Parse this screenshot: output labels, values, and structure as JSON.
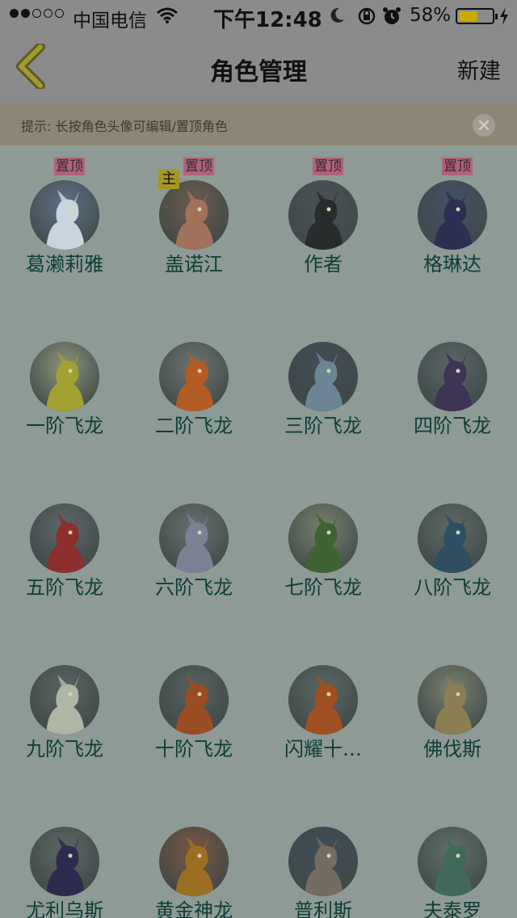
{
  "status_bar": {
    "carrier": "中国电信",
    "time": "下午12:48",
    "battery": "58%",
    "battery_level": 0.58,
    "signal_bars": 2
  },
  "nav": {
    "title": "角色管理",
    "new_label": "新建"
  },
  "tip": {
    "text": "提示: 长按角色头像可编辑/置顶角色"
  },
  "pin_label": "置顶",
  "main_label": "主",
  "characters": [
    {
      "name": "葛濑莉雅",
      "pinned": true,
      "main": false,
      "colors": [
        "#5f7087",
        "#c8d4de"
      ]
    },
    {
      "name": "盖诺江",
      "pinned": true,
      "main": true,
      "colors": [
        "#6b5a4b",
        "#a1715a"
      ]
    },
    {
      "name": "作者",
      "pinned": true,
      "main": false,
      "colors": [
        "#4b5256",
        "#292c2d"
      ]
    },
    {
      "name": "格琳达",
      "pinned": true,
      "main": false,
      "colors": [
        "#45506a",
        "#2d2f53"
      ]
    },
    {
      "name": "一阶飞龙",
      "pinned": false,
      "main": false,
      "colors": [
        "#8c937a",
        "#a3a032"
      ]
    },
    {
      "name": "二阶飞龙",
      "pinned": false,
      "main": false,
      "colors": [
        "#6c7471",
        "#b35d24"
      ]
    },
    {
      "name": "三阶飞龙",
      "pinned": false,
      "main": false,
      "colors": [
        "#424c56",
        "#6b8596"
      ]
    },
    {
      "name": "四阶飞龙",
      "pinned": false,
      "main": false,
      "colors": [
        "#5c6566",
        "#3d3456"
      ]
    },
    {
      "name": "五阶飞龙",
      "pinned": false,
      "main": false,
      "colors": [
        "#5e6668",
        "#8d2f2c"
      ]
    },
    {
      "name": "六阶飞龙",
      "pinned": false,
      "main": false,
      "colors": [
        "#68706f",
        "#7b8296"
      ]
    },
    {
      "name": "七阶飞龙",
      "pinned": false,
      "main": false,
      "colors": [
        "#79826d",
        "#3f6232"
      ]
    },
    {
      "name": "八阶飞龙",
      "pinned": false,
      "main": false,
      "colors": [
        "#5e6864",
        "#2e4f63"
      ]
    },
    {
      "name": "九阶飞龙",
      "pinned": false,
      "main": false,
      "colors": [
        "#5b6360",
        "#b0b6a6"
      ]
    },
    {
      "name": "十阶飞龙",
      "pinned": false,
      "main": false,
      "colors": [
        "#56615f",
        "#9a4d22"
      ]
    },
    {
      "name": "闪耀十…",
      "pinned": false,
      "main": false,
      "colors": [
        "#5a6462",
        "#a04f22"
      ]
    },
    {
      "name": "佛伐斯",
      "pinned": false,
      "main": false,
      "colors": [
        "#7b8170",
        "#8a7e52"
      ]
    },
    {
      "name": "尤利乌斯",
      "pinned": false,
      "main": false,
      "colors": [
        "#5b6665",
        "#2e2c4e"
      ]
    },
    {
      "name": "黄金神龙",
      "pinned": false,
      "main": false,
      "colors": [
        "#7a5442",
        "#9b6e22"
      ]
    },
    {
      "name": "普利斯",
      "pinned": false,
      "main": false,
      "colors": [
        "#404d58",
        "#746b62"
      ]
    },
    {
      "name": "夫泰罗",
      "pinned": false,
      "main": false,
      "colors": [
        "#5f7069",
        "#3f6a5a"
      ]
    }
  ]
}
